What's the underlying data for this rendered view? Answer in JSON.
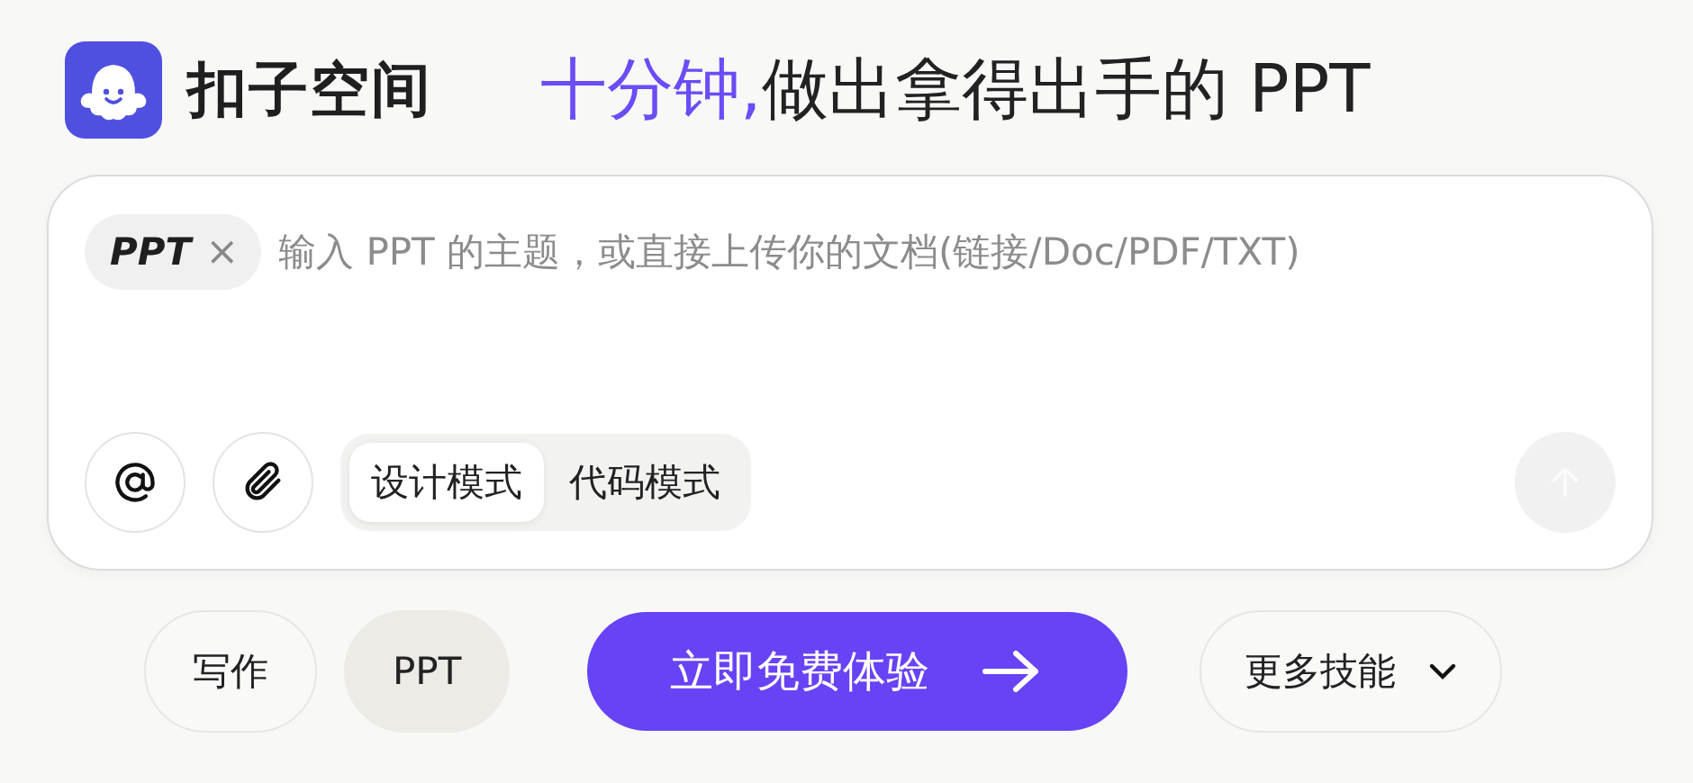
{
  "brand": {
    "name": "扣子空间"
  },
  "slogan": {
    "highlight": "十分钟,",
    "rest": "做出拿得出手的 PPT"
  },
  "composer": {
    "chip": {
      "label": "PPT",
      "remove": "×"
    },
    "placeholder": "输入 PPT 的主题，或直接上传你的文档(链接/Doc/PDF/TXT)",
    "modes": [
      {
        "label": "设计模式",
        "selected": true
      },
      {
        "label": "代码模式",
        "selected": false
      }
    ],
    "send_disabled": true
  },
  "skills": [
    {
      "label": "写作",
      "selected": false
    },
    {
      "label": "PPT",
      "selected": true
    }
  ],
  "cta": {
    "label": "立即免费体验"
  },
  "more": {
    "label": "更多技能"
  }
}
